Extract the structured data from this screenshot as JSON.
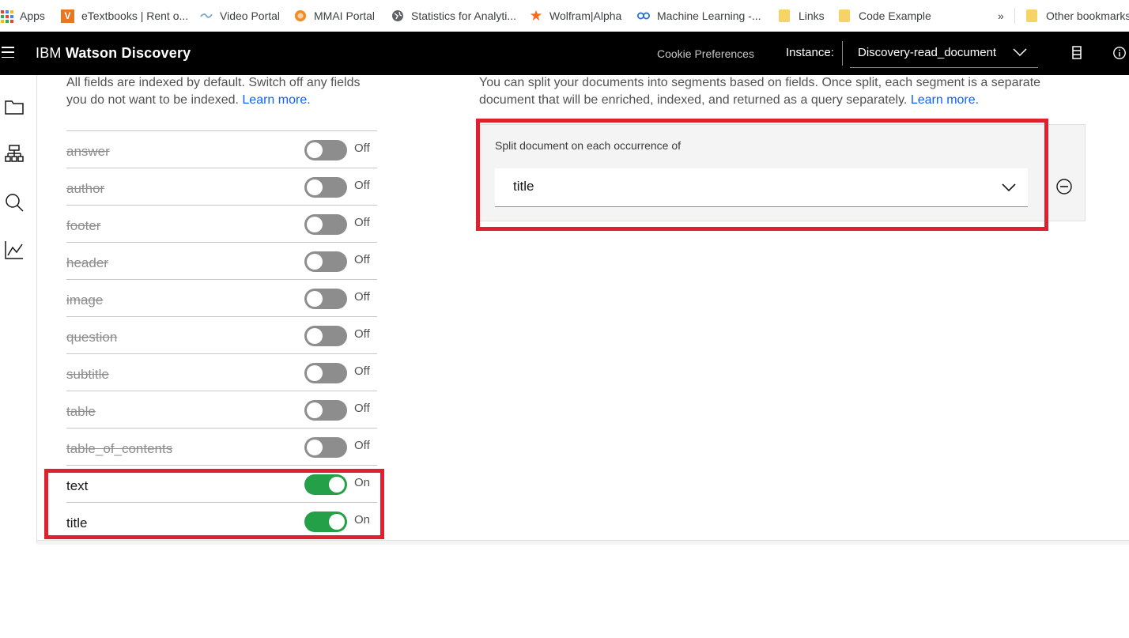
{
  "bookmarks": {
    "items": [
      {
        "label": "Apps",
        "icon": "apps-grid-icon"
      },
      {
        "label": "eTextbooks | Rent o...",
        "icon": "vitalsource-icon"
      },
      {
        "label": "Video Portal",
        "icon": "video-portal-icon"
      },
      {
        "label": "MMAI Portal",
        "icon": "mmai-icon"
      },
      {
        "label": "Statistics for Analyti...",
        "icon": "globe-icon"
      },
      {
        "label": "Wolfram|Alpha",
        "icon": "wolfram-icon"
      },
      {
        "label": "Machine Learning -...",
        "icon": "coursera-icon"
      },
      {
        "label": "Links",
        "icon": "folder-icon"
      },
      {
        "label": "Code Example",
        "icon": "folder-icon"
      }
    ],
    "overflow": "»",
    "other": "Other bookmarks"
  },
  "header": {
    "brand_prefix": "IBM",
    "brand_name": "Watson Discovery",
    "cookie": "Cookie Preferences",
    "instance_label": "Instance:",
    "instance_value": "Discovery-read_document"
  },
  "index_panel": {
    "description": "All fields are indexed by default. Switch off any fields you do not want to be indexed.",
    "learn_more": "Learn more.",
    "fields": [
      {
        "name": "answer",
        "state": "Off"
      },
      {
        "name": "author",
        "state": "Off"
      },
      {
        "name": "footer",
        "state": "Off"
      },
      {
        "name": "header",
        "state": "Off"
      },
      {
        "name": "image",
        "state": "Off"
      },
      {
        "name": "question",
        "state": "Off"
      },
      {
        "name": "subtitle",
        "state": "Off"
      },
      {
        "name": "table",
        "state": "Off"
      },
      {
        "name": "table_of_contents",
        "state": "Off"
      },
      {
        "name": "text",
        "state": "On"
      },
      {
        "name": "title",
        "state": "On"
      }
    ]
  },
  "split_panel": {
    "description": "You can split your documents into segments based on fields. Once split, each segment is a separate document that will be enriched, indexed, and returned as a query separately.",
    "learn_more": "Learn more.",
    "label": "Split document on each occurrence of",
    "selected": "title"
  },
  "colors": {
    "toggle_on": "#24a148",
    "toggle_off": "#8d8d8d",
    "highlight": "#e0202e",
    "link": "#0f62fe"
  }
}
